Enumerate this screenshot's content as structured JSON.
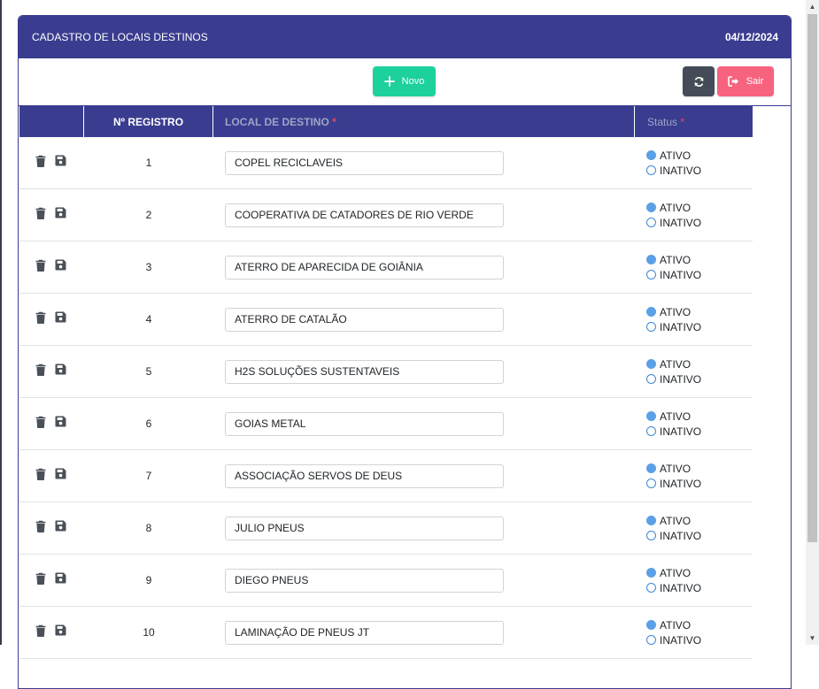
{
  "header": {
    "title": "CADASTRO DE LOCAIS DESTINOS",
    "date": "04/12/2024"
  },
  "toolbar": {
    "novo_label": "Novo",
    "sair_label": "Sair"
  },
  "columns": {
    "registro": "Nº REGISTRO",
    "local": "LOCAL DE DESTINO",
    "status": "Status",
    "required_mark": "*"
  },
  "status_options": {
    "active": "ATIVO",
    "inactive": "INATIVO"
  },
  "rows": [
    {
      "n": "1",
      "local": "COPEL RECICLAVEIS",
      "status": "ATIVO"
    },
    {
      "n": "2",
      "local": "COOPERATIVA DE CATADORES DE RIO VERDE",
      "status": "ATIVO"
    },
    {
      "n": "3",
      "local": "ATERRO DE APARECIDA DE GOIÂNIA",
      "status": "ATIVO"
    },
    {
      "n": "4",
      "local": "ATERRO DE CATALÃO",
      "status": "ATIVO"
    },
    {
      "n": "5",
      "local": "H2S SOLUÇÕES SUSTENTAVEIS",
      "status": "ATIVO"
    },
    {
      "n": "6",
      "local": "GOIAS METAL",
      "status": "ATIVO"
    },
    {
      "n": "7",
      "local": "ASSOCIAÇÃO SERVOS DE DEUS",
      "status": "ATIVO"
    },
    {
      "n": "8",
      "local": "JULIO PNEUS",
      "status": "ATIVO"
    },
    {
      "n": "9",
      "local": "DIEGO PNEUS",
      "status": "ATIVO"
    },
    {
      "n": "10",
      "local": "LAMINAÇÃO DE PNEUS JT",
      "status": "ATIVO"
    }
  ],
  "colors": {
    "primary": "#3a3d8f",
    "novo": "#1dd19d",
    "refresh": "#454c57",
    "sair": "#f7637f",
    "radio": "#5aa0e6"
  },
  "icons": {
    "novo": "plus-icon",
    "refresh": "refresh-icon",
    "sair": "sign-out-icon",
    "delete": "trash-icon",
    "save": "floppy-disk-icon"
  }
}
